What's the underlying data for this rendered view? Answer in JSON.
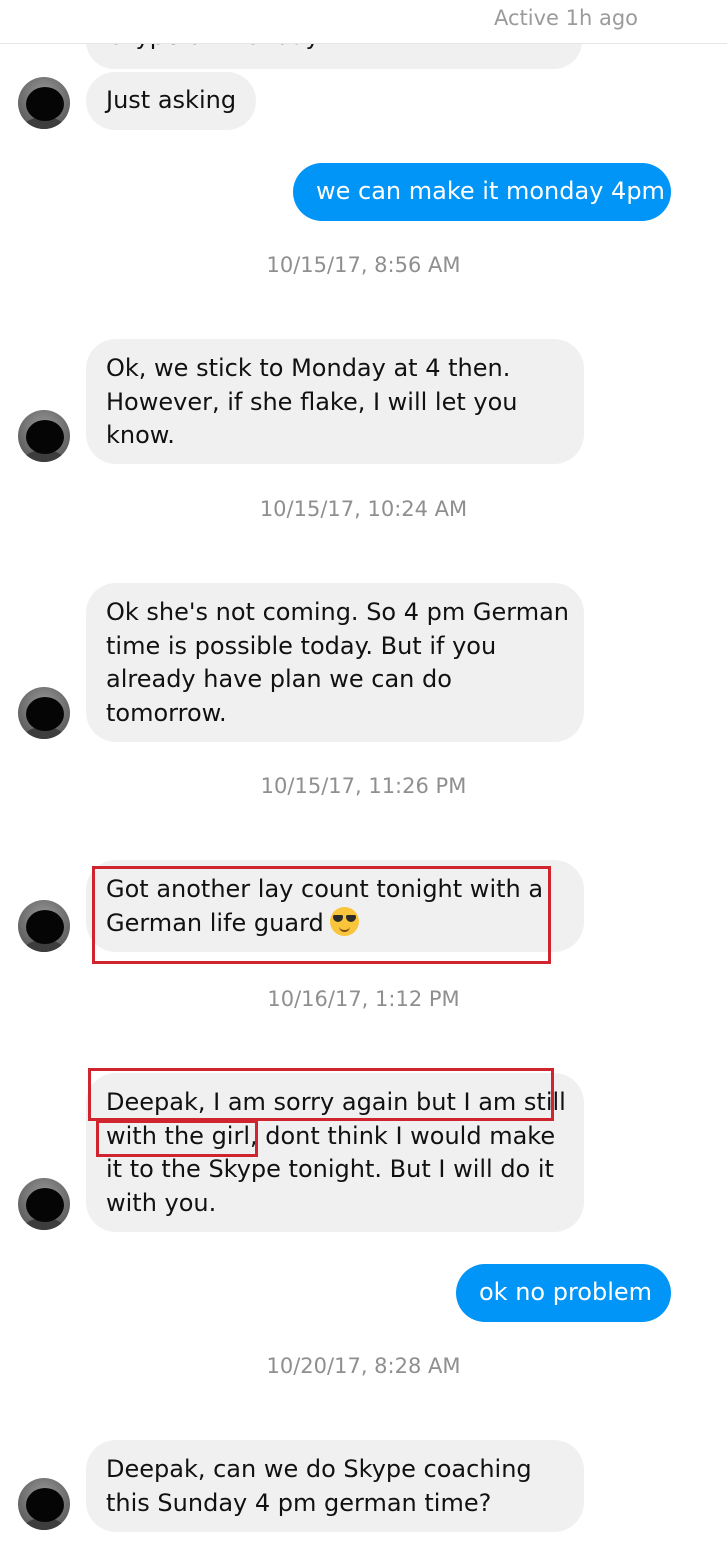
{
  "header": {
    "status": "Active 1h ago"
  },
  "messages": {
    "m0_partial": "skype on Monday?",
    "m1": "Just asking",
    "m2_out": "we can make it monday 4pm",
    "ts1": "10/15/17, 8:56 AM",
    "m3": [
      "Ok, we stick to Monday at 4 then.",
      "However, if she flake, I will let you",
      "know."
    ],
    "ts2": "10/15/17, 10:24 AM",
    "m4": [
      "Ok she's not coming. So 4 pm German",
      "time is possible today. But if you",
      "already have plan we can do",
      "tomorrow."
    ],
    "ts3": "10/15/17, 11:26 PM",
    "m5": [
      "Got another lay count tonight with a",
      "German life guard"
    ],
    "m5_emoji": "smiling-face-with-sunglasses",
    "ts4": "10/16/17, 1:12 PM",
    "m6": [
      "Deepak, I am sorry again but I am still",
      "with the girl, dont think I would make",
      "it to the Skype tonight. But I will do it",
      "with you."
    ],
    "m7_out": "ok no problem",
    "ts5": "10/20/17, 8:28 AM",
    "m8": [
      "Deepak, can we do Skype coaching",
      "this Sunday 4 pm german time?"
    ]
  },
  "colors": {
    "outgoing_bubble": "#0095f6",
    "incoming_bubble": "#f0f0f0",
    "highlight": "#d0252f"
  }
}
